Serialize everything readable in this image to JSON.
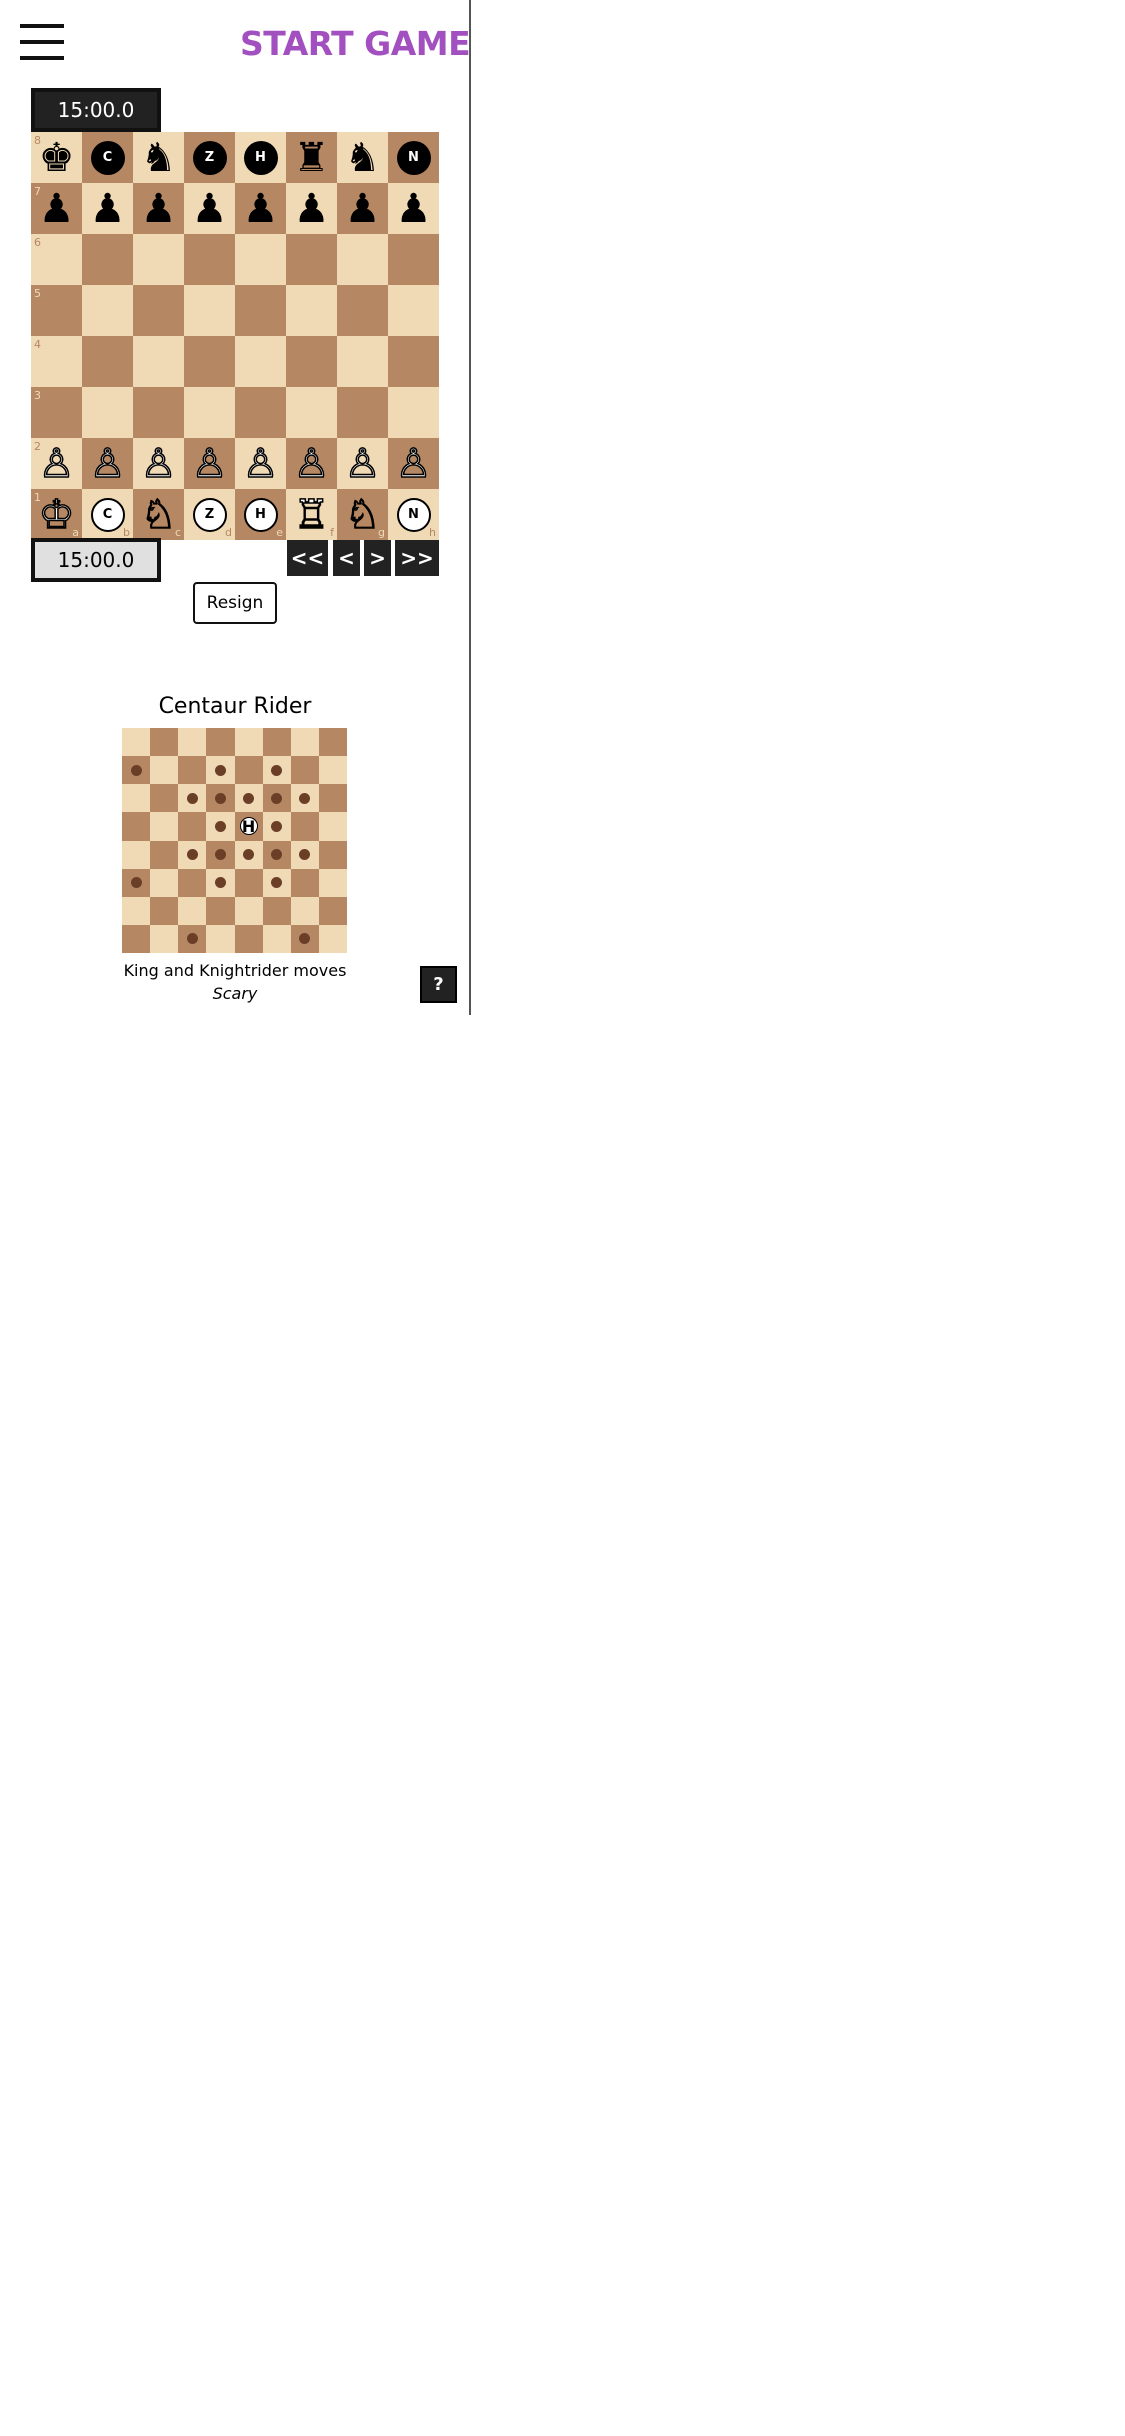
{
  "header": {
    "menu_icon": "hamburger-menu-icon",
    "start_game_label": "START GAME"
  },
  "clocks": {
    "black": "15:00.0",
    "white": "15:00.0"
  },
  "board": {
    "ranks": [
      "8",
      "7",
      "6",
      "5",
      "4",
      "3",
      "2",
      "1"
    ],
    "files": [
      "a",
      "b",
      "c",
      "d",
      "e",
      "f",
      "g",
      "h"
    ],
    "colors": {
      "light": "#f0d9b5",
      "dark": "#b58863"
    },
    "position": [
      [
        {
          "g": "♚",
          "c": "black",
          "n": "king"
        },
        {
          "g": "C",
          "c": "black",
          "n": "camel",
          "fairy": true
        },
        {
          "g": "♞",
          "c": "black",
          "n": "knight"
        },
        {
          "g": "Z",
          "c": "black",
          "n": "zebra",
          "fairy": true
        },
        {
          "g": "H",
          "c": "black",
          "n": "centaur-rider",
          "fairy": true
        },
        {
          "g": "♜",
          "c": "black",
          "n": "rook"
        },
        {
          "g": "♞",
          "c": "black",
          "n": "knight"
        },
        {
          "g": "N",
          "c": "black",
          "n": "nightrider",
          "fairy": true
        }
      ],
      [
        {
          "g": "♟",
          "c": "black",
          "n": "pawn"
        },
        {
          "g": "♟",
          "c": "black",
          "n": "pawn"
        },
        {
          "g": "♟",
          "c": "black",
          "n": "pawn"
        },
        {
          "g": "♟",
          "c": "black",
          "n": "pawn"
        },
        {
          "g": "♟",
          "c": "black",
          "n": "pawn"
        },
        {
          "g": "♟",
          "c": "black",
          "n": "pawn"
        },
        {
          "g": "♟",
          "c": "black",
          "n": "pawn"
        },
        {
          "g": "♟",
          "c": "black",
          "n": "pawn"
        }
      ],
      [
        null,
        null,
        null,
        null,
        null,
        null,
        null,
        null
      ],
      [
        null,
        null,
        null,
        null,
        null,
        null,
        null,
        null
      ],
      [
        null,
        null,
        null,
        null,
        null,
        null,
        null,
        null
      ],
      [
        null,
        null,
        null,
        null,
        null,
        null,
        null,
        null
      ],
      [
        {
          "g": "♙",
          "c": "white",
          "n": "pawn"
        },
        {
          "g": "♙",
          "c": "white",
          "n": "pawn"
        },
        {
          "g": "♙",
          "c": "white",
          "n": "pawn"
        },
        {
          "g": "♙",
          "c": "white",
          "n": "pawn"
        },
        {
          "g": "♙",
          "c": "white",
          "n": "pawn"
        },
        {
          "g": "♙",
          "c": "white",
          "n": "pawn"
        },
        {
          "g": "♙",
          "c": "white",
          "n": "pawn"
        },
        {
          "g": "♙",
          "c": "white",
          "n": "pawn"
        }
      ],
      [
        {
          "g": "♔",
          "c": "white",
          "n": "king"
        },
        {
          "g": "C",
          "c": "white",
          "n": "camel",
          "fairy": true
        },
        {
          "g": "♘",
          "c": "white",
          "n": "knight"
        },
        {
          "g": "Z",
          "c": "white",
          "n": "zebra",
          "fairy": true
        },
        {
          "g": "H",
          "c": "white",
          "n": "centaur-rider",
          "fairy": true
        },
        {
          "g": "♖",
          "c": "white",
          "n": "rook"
        },
        {
          "g": "♘",
          "c": "white",
          "n": "knight"
        },
        {
          "g": "N",
          "c": "white",
          "n": "nightrider",
          "fairy": true
        }
      ]
    ]
  },
  "nav": {
    "first": "<<",
    "prev": "<",
    "next": ">",
    "last": ">>"
  },
  "resign_label": "Resign",
  "piece_info": {
    "title": "Centaur Rider",
    "description": "King and Knightrider moves",
    "tagline": "Scary",
    "piece_square": [
      3,
      4
    ],
    "move_dots": [
      [
        1,
        0
      ],
      [
        1,
        3
      ],
      [
        1,
        5
      ],
      [
        2,
        2
      ],
      [
        2,
        3
      ],
      [
        2,
        4
      ],
      [
        2,
        5
      ],
      [
        2,
        6
      ],
      [
        3,
        3
      ],
      [
        3,
        5
      ],
      [
        4,
        2
      ],
      [
        4,
        3
      ],
      [
        4,
        4
      ],
      [
        4,
        5
      ],
      [
        4,
        6
      ],
      [
        5,
        0
      ],
      [
        5,
        3
      ],
      [
        5,
        5
      ],
      [
        7,
        2
      ],
      [
        7,
        6
      ]
    ],
    "dot_color": "#6b3f27"
  },
  "help_label": "?",
  "colors": {
    "accent": "#a24fbf",
    "dark_button": "#222222"
  }
}
